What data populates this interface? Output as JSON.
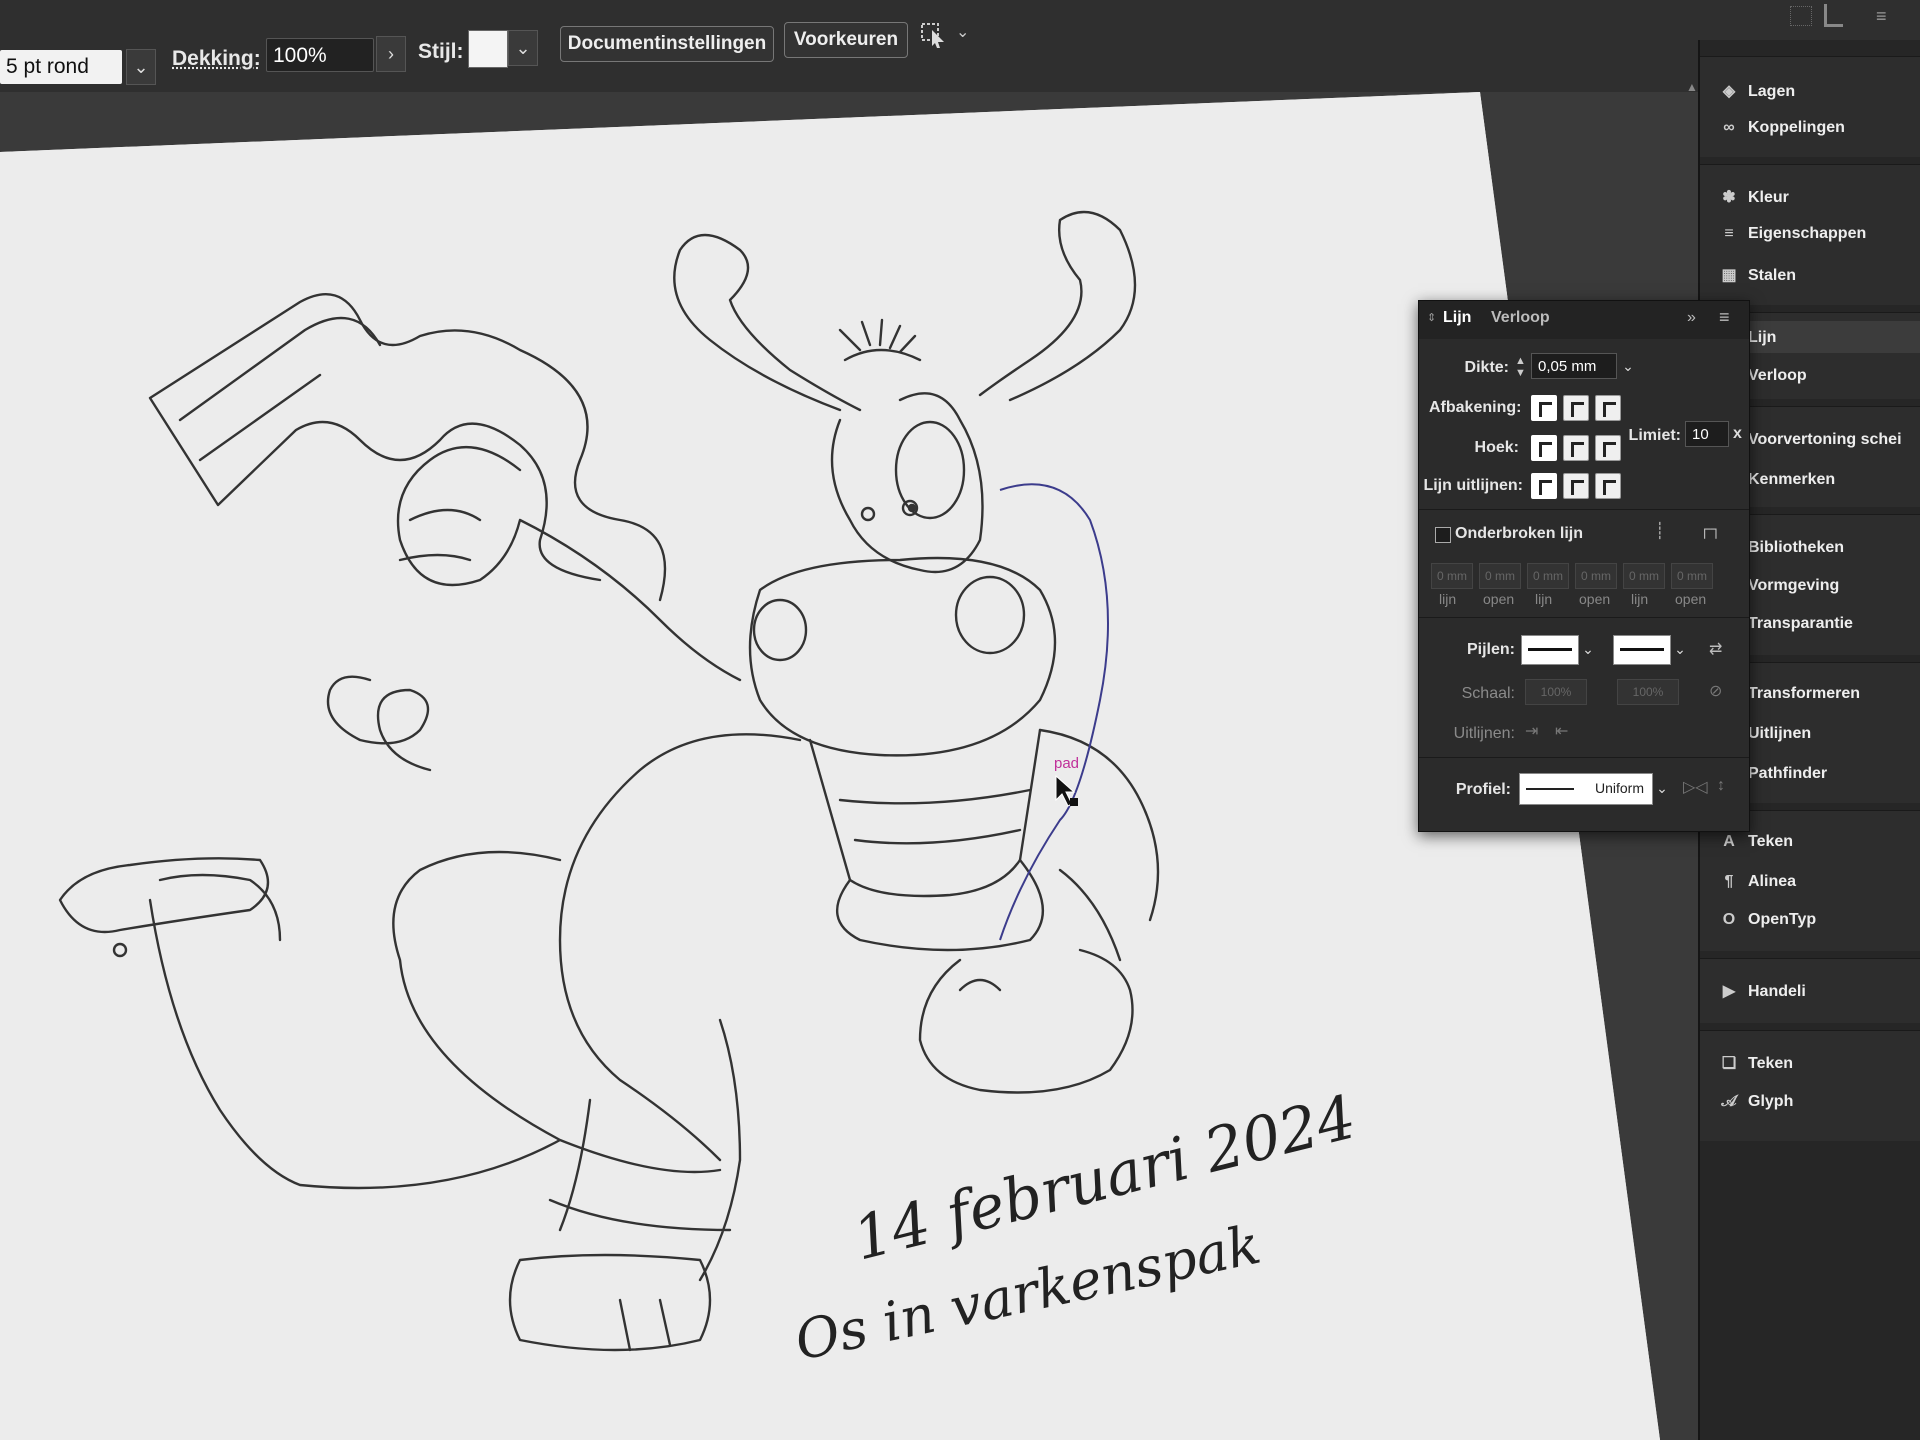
{
  "control_bar": {
    "stroke_type_value": "5 pt rond",
    "opacity_label": "Dekking:",
    "opacity_value": "100%",
    "style_label": "Stijl:",
    "document_settings_button": "Documentinstellingen",
    "preferences_button": "Voorkeuren"
  },
  "dock": {
    "groups": [
      {
        "items": [
          {
            "label": "Lagen",
            "icon": "layers-icon"
          },
          {
            "label": "Koppelingen",
            "icon": "links-icon"
          }
        ]
      },
      {
        "items": [
          {
            "label": "Kleur",
            "icon": "color-palette-icon"
          },
          {
            "label": "Eigenschappen",
            "icon": "properties-sliders-icon"
          },
          {
            "label": "Stalen",
            "icon": "swatches-grid-icon"
          }
        ]
      },
      {
        "items": [
          {
            "label": "Lijn",
            "icon": "stroke-lines-icon"
          },
          {
            "label": "Verloop",
            "icon": "gradient-icon"
          }
        ]
      },
      {
        "items": [
          {
            "label": "Voorvertoning schei",
            "icon": "separations-preview-icon"
          },
          {
            "label": "Kenmerken",
            "icon": "attributes-icon"
          }
        ]
      },
      {
        "items": [
          {
            "label": "Bibliotheken",
            "icon": "libraries-icon"
          },
          {
            "label": "Vormgeving",
            "icon": "appearance-icon"
          },
          {
            "label": "Transparantie",
            "icon": "transparency-icon"
          }
        ]
      },
      {
        "items": [
          {
            "label": "Transformeren",
            "icon": "transform-icon"
          },
          {
            "label": "Uitlijnen",
            "icon": "align-icon"
          },
          {
            "label": "Pathfinder",
            "icon": "pathfinder-icon"
          }
        ]
      },
      {
        "items": [
          {
            "label": "Teken",
            "icon": "character-icon"
          },
          {
            "label": "Alinea",
            "icon": "paragraph-icon"
          },
          {
            "label": "OpenTyp",
            "icon": "opentype-icon"
          }
        ]
      },
      {
        "items": [
          {
            "label": "Handeli",
            "icon": "actions-play-icon"
          }
        ]
      },
      {
        "items": [
          {
            "label": "Teken",
            "icon": "character-styles-icon"
          },
          {
            "label": "Glyph",
            "icon": "glyphs-icon"
          }
        ]
      }
    ]
  },
  "stroke_panel": {
    "tab_active": "Lijn",
    "tab_inactive": "Verloop",
    "weight_label": "Dikte:",
    "weight_value": "0,05 mm",
    "cap_label": "Afbakening:",
    "join_label": "Hoek:",
    "miter_label": "Limiet:",
    "miter_value": "10",
    "miter_unit": "x",
    "align_label": "Lijn uitlijnen:",
    "dashed_label": "Onderbroken lijn",
    "dashed_checked": false,
    "dash_values": [
      "0 mm",
      "0 mm",
      "0 mm",
      "0 mm",
      "0 mm",
      "0 mm"
    ],
    "dash_labels": [
      "lijn",
      "open",
      "lijn",
      "open",
      "lijn",
      "open"
    ],
    "arrows_label": "Pijlen:",
    "scale_label": "Schaal:",
    "scale_start": "100%",
    "scale_end": "100%",
    "arrow_align_label": "Uitlijnen:",
    "profile_label": "Profiel:",
    "profile_value": "Uniform"
  },
  "canvas": {
    "path_hint": "pad",
    "handwriting_line1": "14 februari 2024",
    "handwriting_line2": "Os in varkenspak",
    "selected_path_color": "#3c3c8c",
    "hint_color": "#c0309a",
    "sketch_color": "#333333"
  }
}
